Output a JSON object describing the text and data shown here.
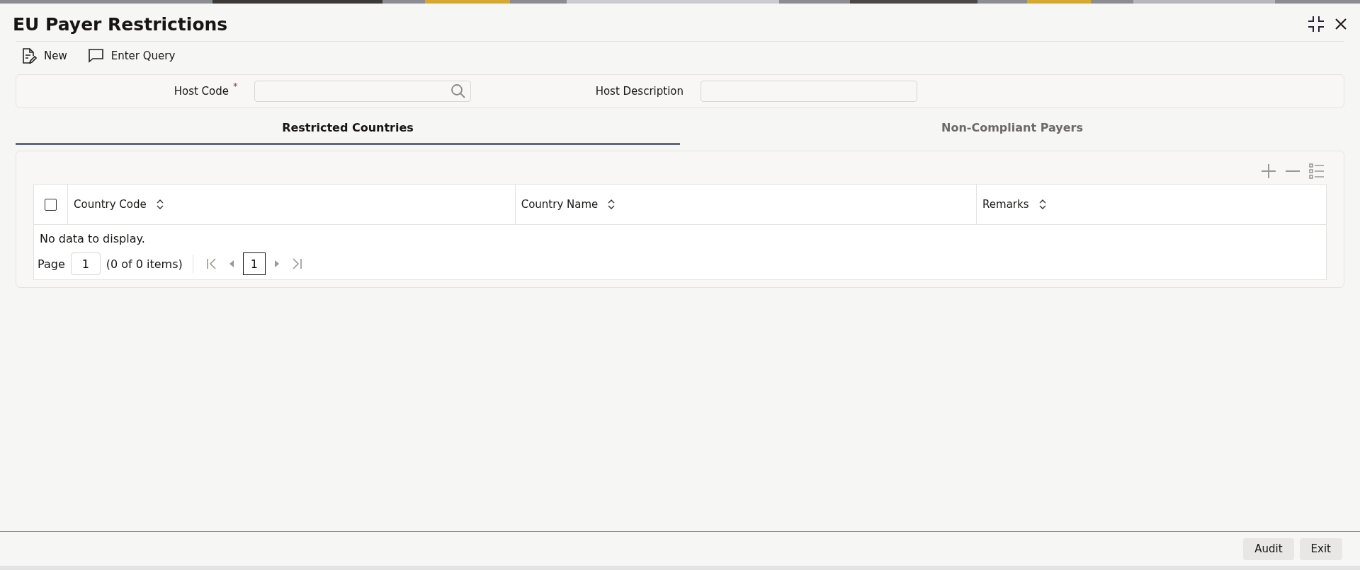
{
  "window": {
    "title": "EU Payer Restrictions"
  },
  "toolbar": [
    {
      "kind": "new",
      "label": "New"
    },
    {
      "kind": "query",
      "label": "Enter Query"
    }
  ],
  "fields": [
    {
      "label": "Host Code",
      "required_mark": "*",
      "search": true
    },
    {
      "label": "Host Description",
      "search": false
    }
  ],
  "tabs": [
    {
      "label": "Restricted Countries",
      "selected": true
    },
    {
      "label": "Non-Compliant Payers",
      "selected": false
    }
  ],
  "table": {
    "select_all": {
      "checked": false
    },
    "columns": [
      "Country Code",
      "Country Name",
      "Remarks"
    ],
    "empty_message": "No data to display."
  },
  "pagination": {
    "label": "Page",
    "page": "1",
    "summary": "(0 of 0 items)",
    "current": "1"
  },
  "footer_buttons": [
    "Audit",
    "Exit"
  ]
}
